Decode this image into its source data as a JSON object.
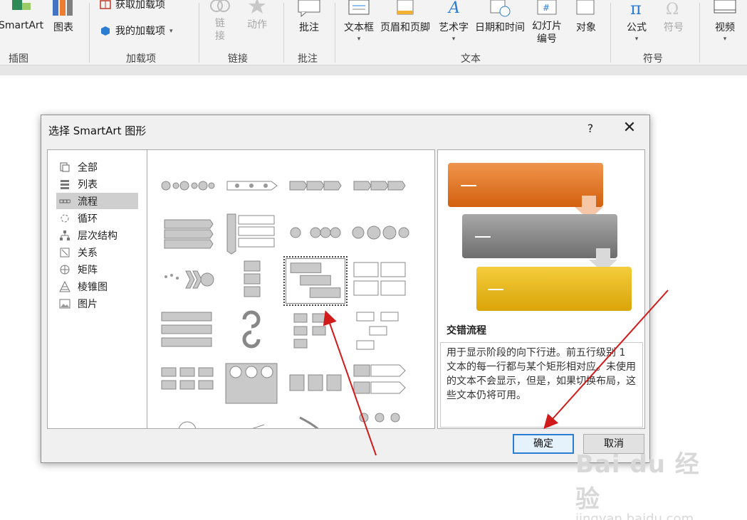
{
  "ribbon": {
    "smartart_label": "SmartArt",
    "chart_label": "图表",
    "get_addins_label": "获取加载项",
    "my_addins_label": "我的加载项",
    "link_label": "链\n接",
    "action_label": "动作",
    "comment_label": "批注",
    "textbox_label": "文本框",
    "header_footer_label": "页眉和页脚",
    "wordart_label": "艺术字",
    "datetime_label": "日期和时间",
    "slide_number_label": "幻灯片\n编号",
    "object_label": "对象",
    "equation_label": "公式",
    "symbol_label": "符号",
    "video_label": "视频",
    "groups": {
      "illustrations": "插图",
      "addins": "加载项",
      "links": "链接",
      "comments": "批注",
      "text": "文本",
      "symbols": "符号"
    }
  },
  "dialog": {
    "title": "选择 SmartArt 图形",
    "help": "?",
    "close": "✕",
    "categories": [
      {
        "label": "全部",
        "icon": "all-icon",
        "selected": false
      },
      {
        "label": "列表",
        "icon": "list-icon",
        "selected": false
      },
      {
        "label": "流程",
        "icon": "process-icon",
        "selected": true
      },
      {
        "label": "循环",
        "icon": "cycle-icon",
        "selected": false
      },
      {
        "label": "层次结构",
        "icon": "hierarchy-icon",
        "selected": false
      },
      {
        "label": "关系",
        "icon": "relationship-icon",
        "selected": false
      },
      {
        "label": "矩阵",
        "icon": "matrix-icon",
        "selected": false
      },
      {
        "label": "棱锥图",
        "icon": "pyramid-icon",
        "selected": false
      },
      {
        "label": "图片",
        "icon": "picture-icon",
        "selected": false
      }
    ],
    "preview": {
      "name": "交错流程",
      "description": "用于显示阶段的向下行进。前五行级别 1 文本的每一行都与某个矩形相对应。未使用的文本不会显示，但是，如果切换布局，这些文本仍将可用。",
      "colors": [
        "#e0762a",
        "#8a8a8a",
        "#e7b81e"
      ]
    },
    "ok_label": "确定",
    "cancel_label": "取消"
  },
  "watermark": {
    "logo": "Bai du 经验",
    "url": "jingyan.baidu.com"
  },
  "colors": {
    "annotation_arrow": "#d11a1a",
    "accent_blue": "#2b7cd3"
  }
}
